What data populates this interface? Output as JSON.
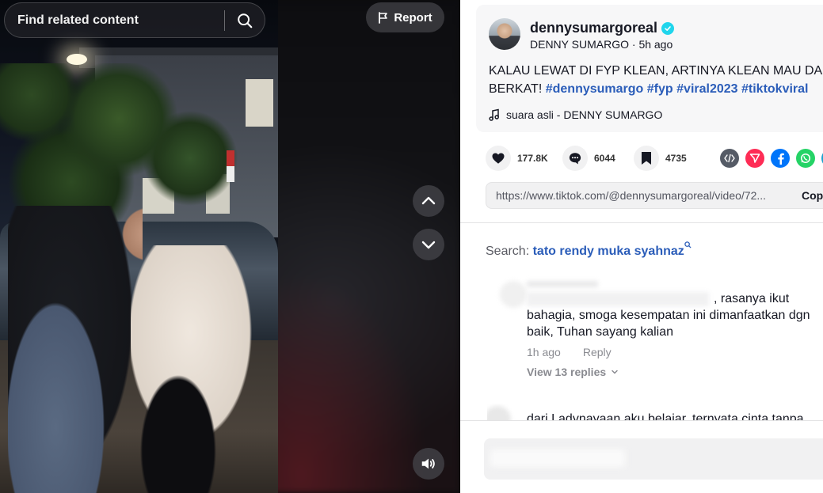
{
  "video_panel": {
    "search_placeholder": "Find related content",
    "report_label": "Report",
    "icons": {
      "search": "search-icon",
      "report": "flag-icon",
      "up": "chevron-up-icon",
      "down": "chevron-down-icon",
      "volume": "volume-icon"
    }
  },
  "post": {
    "username": "dennysumargoreal",
    "display_name": "DENNY SUMARGO",
    "time_ago": "5h ago",
    "caption_text_1": "KALAU LEWAT DI FYP KLEAN, ARTINYA KLEAN MAU DAPAT",
    "caption_text_2": "BERKAT!",
    "hashtags": [
      "#dennysumargo",
      "#fyp",
      "#viral2023",
      "#tiktokviral"
    ],
    "music": "suara asli - DENNY SUMARGO"
  },
  "actions": {
    "likes": "177.8K",
    "comments": "6044",
    "saves": "4735"
  },
  "share": {
    "url": "https://www.tiktok.com/@dennysumargoreal/video/72...",
    "copy_label": "Copy link"
  },
  "related": {
    "label": "Search:",
    "keyword": "tato rendy muka syahnaz"
  },
  "comment": {
    "text_1": ", rasanya ikut",
    "text_2": "bahagia, smoga kesempatan ini dimanfaatkan dgn",
    "text_3": "baik, Tuhan sayang kalian",
    "time": "1h ago",
    "reply_label": "Reply",
    "view_replies": "View 13 replies"
  },
  "comment2": {
    "text": "dari Ladynayaan aku belajar, ternyata cinta tanpa"
  },
  "colors": {
    "accent_hashtag": "#2b5db9",
    "verified": "#20d5ec",
    "brand_red": "#fe2c55"
  }
}
